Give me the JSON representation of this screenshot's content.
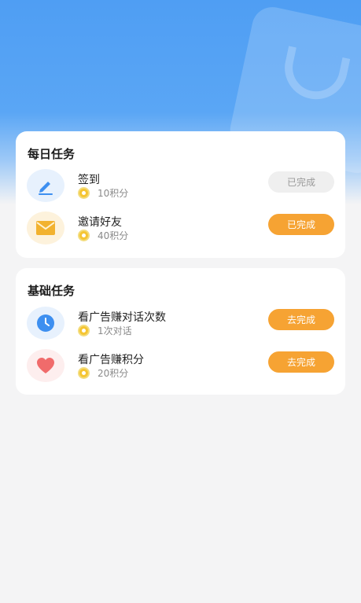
{
  "daily_tasks": {
    "title": "每日任务",
    "items": [
      {
        "name": "签到",
        "reward": "10积分",
        "button": "已完成",
        "icon": "pen-icon",
        "status": "completed"
      },
      {
        "name": "邀请好友",
        "reward": "40积分",
        "button": "已完成",
        "icon": "envelope-icon",
        "status": "action"
      }
    ]
  },
  "basic_tasks": {
    "title": "基础任务",
    "items": [
      {
        "name": "看广告赚对话次数",
        "reward": "1次对话",
        "button": "去完成",
        "icon": "clock-icon",
        "status": "action"
      },
      {
        "name": "看广告赚积分",
        "reward": "20积分",
        "button": "去完成",
        "icon": "heart-icon",
        "status": "action"
      }
    ]
  },
  "colors": {
    "hero_blue": "#4f9ef3",
    "button_orange": "#f6a333",
    "button_grey": "#efefef",
    "coin_gold": "#f5c533"
  }
}
